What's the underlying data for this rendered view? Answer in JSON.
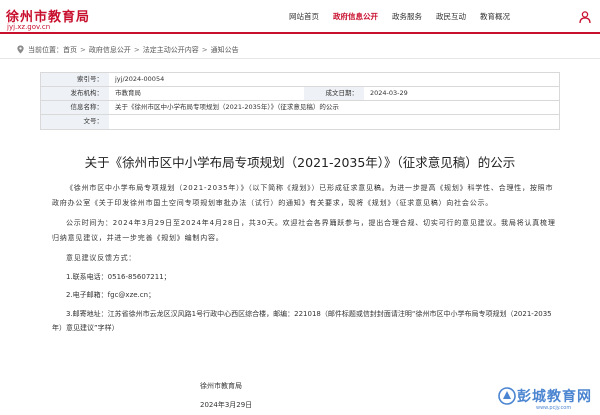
{
  "header": {
    "site_title": "徐州市教育局",
    "site_url": "jyj.xz.gov.cn",
    "nav": [
      {
        "label": "网站首页",
        "active": false
      },
      {
        "label": "政府信息公开",
        "active": true
      },
      {
        "label": "政务服务",
        "active": false
      },
      {
        "label": "政民互动",
        "active": false
      },
      {
        "label": "教育概况",
        "active": false
      }
    ],
    "accent_color": "#c8102e"
  },
  "breadcrumb": {
    "prefix": "当前位置：",
    "items": [
      "首页",
      "政府信息公开",
      "法定主动公开内容",
      "通知公告"
    ],
    "separator": ">"
  },
  "info": {
    "index_label": "索引号：",
    "index_value": "jyj/2024-00054",
    "publisher_label": "发布机构：",
    "publisher_value": "市教育局",
    "date_label": "成文日期：",
    "date_value": "2024-03-29",
    "name_label": "信息名称：",
    "name_value": "关于《徐州市区中小学布局专项规划（2021-2035年）》（征求意见稿）的公示",
    "docno_label": "文号：",
    "docno_value": ""
  },
  "article": {
    "title": "关于《徐州市区中小学布局专项规划（2021-2035年）》（征求意见稿）的公示",
    "p1": "《徐州市区中小学布局专项规划（2021-2035年）》（以下简称《规划》）已形成征求意见稿。为进一步提高《规划》科学性、合理性，按照市政府办公室《关于印发徐州市国土空间专项规划审批办法（试行）的通知》有关要求，现将《规划》（征求意见稿）向社会公示。",
    "p2": "公示时间为：2024年3月29日至2024年4月28日，共30天。欢迎社会各界踊跃参与，提出合理合规、切实可行的意见建议。我局将认真梳理归纳意见建议，并进一步完善《规划》编制内容。",
    "p3": "意见建议反馈方式：",
    "p4": "1.联系电话：0516-85607211；",
    "p5": "2.电子邮箱：fgc@xze.cn；",
    "p6": "3.邮寄地址：江苏省徐州市云龙区汉风路1号行政中心西区综合楼，邮编：221018（邮件标题或信封封面请注明“徐州市区中小学布局专项规划（2021-2035年）意见建议”字样）",
    "sign_org": "徐州市教育局",
    "sign_date": "2024年3月29日"
  },
  "watermark": {
    "text": "彭城教育网",
    "sub": "www.pcjy.com",
    "color": "#2c70c9"
  }
}
